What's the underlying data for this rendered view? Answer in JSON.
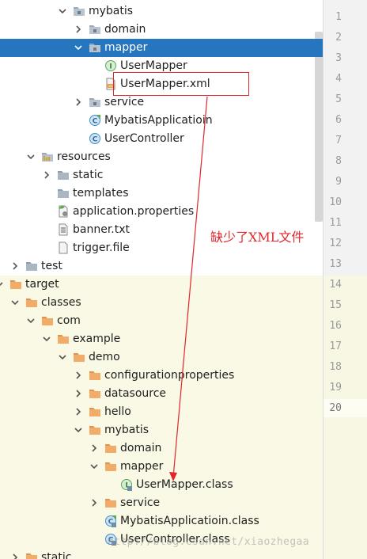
{
  "tree": [
    {
      "label": "mybatis",
      "level": 4,
      "icon": "package-folder-icon",
      "expanded": true
    },
    {
      "label": "domain",
      "level": 5,
      "icon": "package-folder-icon",
      "expanded": false
    },
    {
      "label": "mapper",
      "level": 5,
      "icon": "package-folder-icon",
      "expanded": true,
      "selected": true
    },
    {
      "label": "UserMapper",
      "level": 6,
      "icon": "interface-icon"
    },
    {
      "label": "UserMapper.xml",
      "level": 6,
      "icon": "xml-file-icon"
    },
    {
      "label": "service",
      "level": 5,
      "icon": "package-folder-icon",
      "expanded": false
    },
    {
      "label": "MybatisApplicatioin",
      "level": 5,
      "icon": "spring-class-icon"
    },
    {
      "label": "UserController",
      "level": 5,
      "icon": "class-icon"
    },
    {
      "label": "resources",
      "level": 2,
      "icon": "resources-folder-icon",
      "expanded": true
    },
    {
      "label": "static",
      "level": 3,
      "icon": "folder-icon",
      "expanded": false
    },
    {
      "label": "templates",
      "level": 3,
      "icon": "folder-icon"
    },
    {
      "label": "application.properties",
      "level": 3,
      "icon": "properties-file-icon"
    },
    {
      "label": "banner.txt",
      "level": 3,
      "icon": "text-file-icon"
    },
    {
      "label": "trigger.file",
      "level": 3,
      "icon": "file-icon"
    },
    {
      "label": "test",
      "level": 1,
      "icon": "folder-icon",
      "expanded": false
    },
    {
      "label": "target",
      "level": 0,
      "icon": "orange-folder-icon",
      "expanded": true
    },
    {
      "label": "classes",
      "level": 1,
      "icon": "orange-folder-icon",
      "expanded": true
    },
    {
      "label": "com",
      "level": 2,
      "icon": "orange-folder-icon",
      "expanded": true
    },
    {
      "label": "example",
      "level": 3,
      "icon": "orange-folder-icon",
      "expanded": true
    },
    {
      "label": "demo",
      "level": 4,
      "icon": "orange-folder-icon",
      "expanded": true
    },
    {
      "label": "configurationproperties",
      "level": 5,
      "icon": "orange-folder-icon",
      "expanded": false
    },
    {
      "label": "datasource",
      "level": 5,
      "icon": "orange-folder-icon",
      "expanded": false
    },
    {
      "label": "hello",
      "level": 5,
      "icon": "orange-folder-icon",
      "expanded": false
    },
    {
      "label": "mybatis",
      "level": 5,
      "icon": "orange-folder-icon",
      "expanded": true
    },
    {
      "label": "domain",
      "level": 6,
      "icon": "orange-folder-icon",
      "expanded": false
    },
    {
      "label": "mapper",
      "level": 6,
      "icon": "orange-folder-icon",
      "expanded": true
    },
    {
      "label": "UserMapper.class",
      "level": 7,
      "icon": "compiled-interface-icon"
    },
    {
      "label": "service",
      "level": 6,
      "icon": "orange-folder-icon",
      "expanded": false
    },
    {
      "label": "MybatisApplicatioin.class",
      "level": 6,
      "icon": "compiled-spring-class-icon"
    },
    {
      "label": "UserController.class",
      "level": 6,
      "icon": "compiled-class-icon"
    },
    {
      "label": "static",
      "level": 1,
      "icon": "orange-folder-icon",
      "expanded": false
    }
  ],
  "gutter": {
    "line_numbers": [
      "1",
      "2",
      "3",
      "4",
      "5",
      "6",
      "7",
      "8",
      "9",
      "10",
      "11",
      "12",
      "13",
      "14",
      "15",
      "16",
      "17",
      "18",
      "19",
      "20"
    ],
    "current_line": "20"
  },
  "annotation": {
    "note": "缺少了XML文件",
    "color": "#e3262a"
  },
  "watermark": "http://blog.csdn.net/xiaozhegaa",
  "colors": {
    "selection": "#2675bf",
    "target_background": "#f9f9e6",
    "folder_blue": "#8fa3b8",
    "folder_orange": "#f0a35b"
  }
}
